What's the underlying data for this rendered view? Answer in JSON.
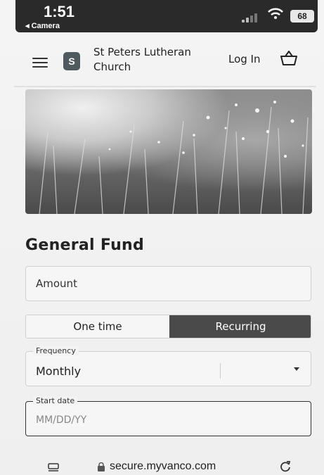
{
  "status_bar": {
    "time": "1:51",
    "back_app": "◂ Camera",
    "battery": "68"
  },
  "header": {
    "logo_letter": "S",
    "church_name": "St Peters Lutheran Church",
    "login_label": "Log In",
    "icons": [
      "hamburger-menu-icon",
      "basket-icon"
    ]
  },
  "fund": {
    "title": "General Fund",
    "amount_label": "Amount",
    "toggle_one_time": "One time",
    "toggle_recurring": "Recurring",
    "toggle_selected": "Recurring",
    "frequency_label": "Frequency",
    "frequency_value": "Monthly",
    "start_date_label": "Start date",
    "start_date_placeholder": "MM/DD/YY"
  },
  "browser": {
    "url": "secure.myvanco.com",
    "icons": [
      "tabs-icon",
      "lock-icon",
      "reload-icon"
    ]
  },
  "colors": {
    "selected_toggle_bg": "#4a4a4a",
    "status_bar_bg": "#2a2a2a"
  }
}
